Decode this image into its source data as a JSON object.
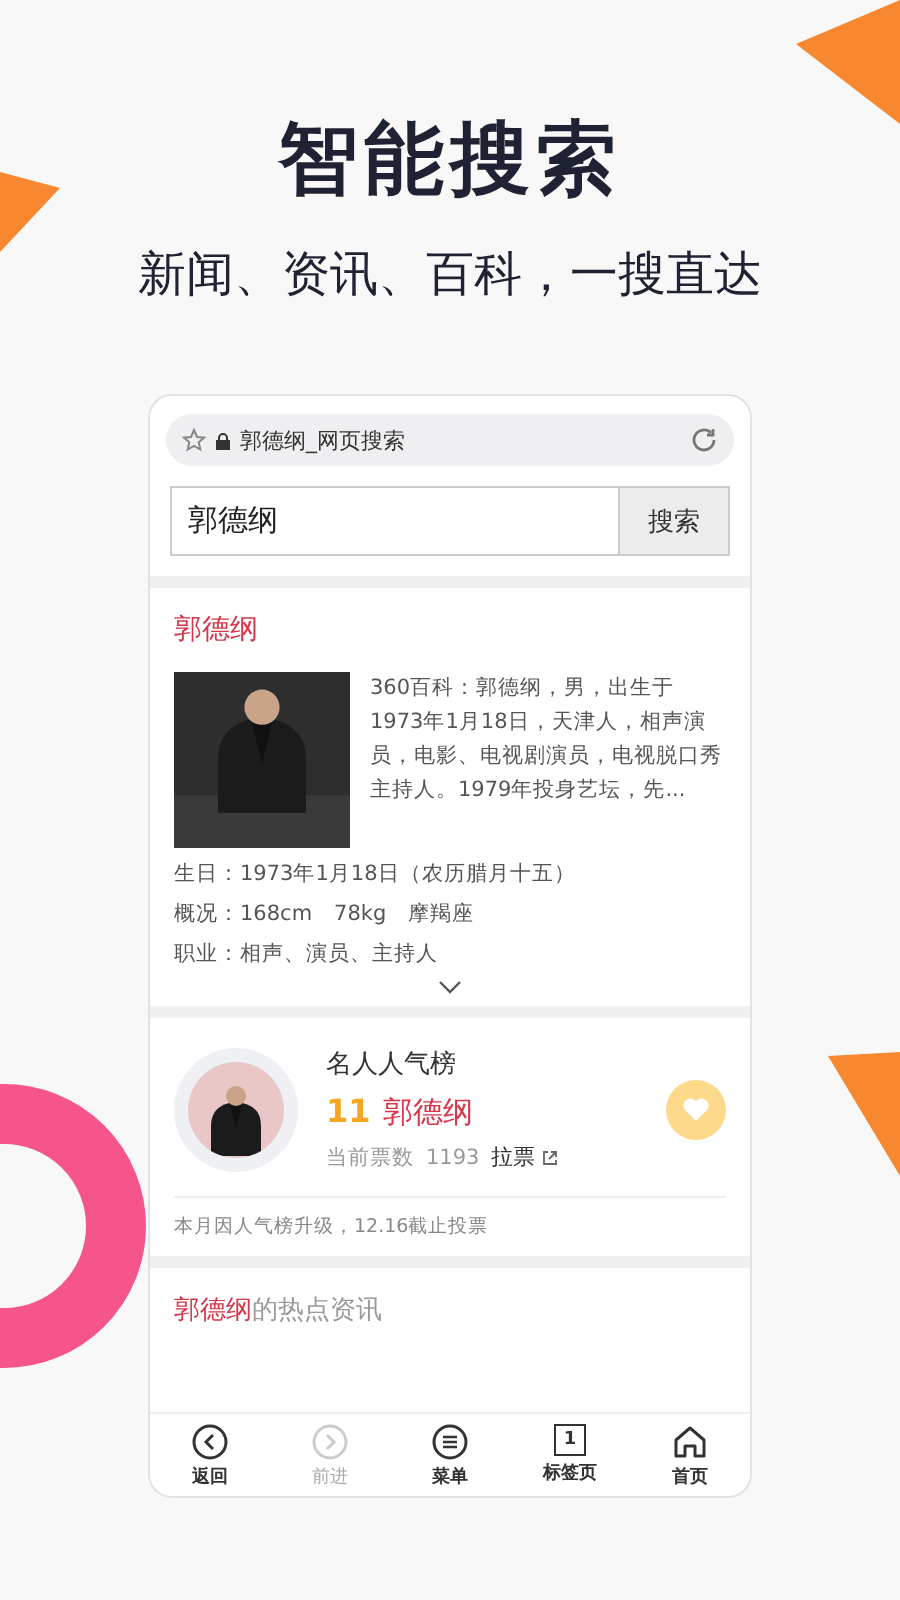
{
  "headline": "智能搜索",
  "tagline": "新闻、资讯、百科，一搜直达",
  "browser": {
    "address": "郭德纲_网页搜索",
    "search_value": "郭德纲",
    "search_button": "搜索"
  },
  "baike": {
    "title": "郭德纲",
    "summary": "360百科：郭德纲，男，出生于1973年1月18日，天津人，相声演员，电影、电视剧演员，电视脱口秀主持人。1979年投身艺坛，先...",
    "facts": [
      "生日：1973年1月18日（农历腊月十五）",
      "概况：168cm　78kg　摩羯座",
      "职业：相声、演员、主持人"
    ]
  },
  "ranking": {
    "title": "名人人气榜",
    "rank": "11",
    "name": "郭德纲",
    "votes_label": "当前票数",
    "votes": "1193",
    "vote_link": "拉票",
    "note": "本月因人气榜升级，12.16截止投票"
  },
  "news": {
    "highlight": "郭德纲",
    "rest": "的热点资讯"
  },
  "nav": [
    {
      "kind": "back",
      "label": "返回",
      "disabled": false
    },
    {
      "kind": "forward",
      "label": "前进",
      "disabled": true
    },
    {
      "kind": "menu",
      "label": "菜单",
      "disabled": false
    },
    {
      "kind": "tabs",
      "label": "标签页",
      "count": "1",
      "disabled": false
    },
    {
      "kind": "home",
      "label": "首页",
      "disabled": false
    }
  ]
}
